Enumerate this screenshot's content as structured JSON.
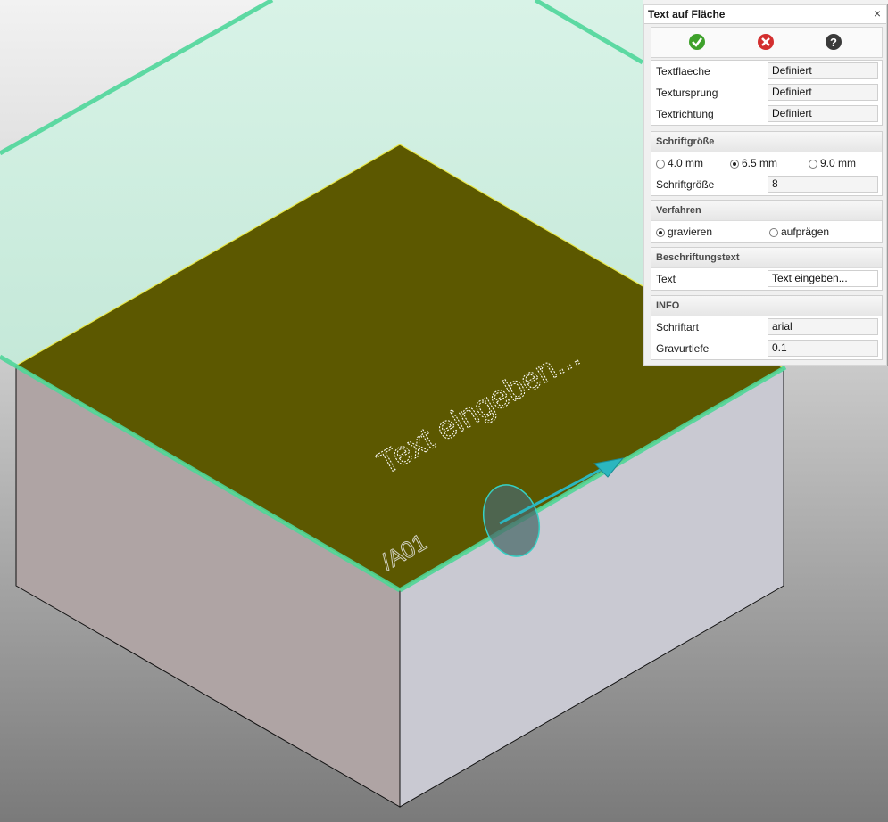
{
  "dialog": {
    "title": "Text auf Fläche",
    "close_glyph": "×",
    "toolbar": {
      "ok_icon": "check-circle-icon",
      "cancel_icon": "x-circle-icon",
      "help_icon": "question-circle-icon",
      "ok_color": "#3ea12b",
      "cancel_color": "#d32f2f",
      "help_color": "#3a3a3a"
    },
    "definition": {
      "rows": [
        {
          "label": "Textflaeche",
          "value": "Definiert"
        },
        {
          "label": "Textursprung",
          "value": "Definiert"
        },
        {
          "label": "Textrichtung",
          "value": "Definiert"
        }
      ]
    },
    "font_size": {
      "header": "Schriftgröße",
      "options": [
        "4.0 mm",
        "6.5 mm",
        "9.0 mm"
      ],
      "selected": "6.5 mm",
      "field_label": "Schriftgröße",
      "field_value": "8"
    },
    "method": {
      "header": "Verfahren",
      "options": [
        "gravieren",
        "aufprägen"
      ],
      "selected": "gravieren"
    },
    "label_text": {
      "header": "Beschriftungstext",
      "field_label": "Text",
      "field_value": "Text eingeben..."
    },
    "info": {
      "header": "INFO",
      "rows": [
        {
          "label": "Schriftart",
          "value": "arial"
        },
        {
          "label": "Gravurtiefe",
          "value": "0.1"
        }
      ]
    }
  },
  "scene": {
    "engraved_text": "Text eingeben...",
    "part_label": "/A01",
    "colors": {
      "top_face": "#5c5800",
      "left_face": "#afa4a4",
      "right_face": "#c9c9d2",
      "preview_plane": "#6fe3b2",
      "text_direction_arrow": "#2bb6bf"
    }
  }
}
